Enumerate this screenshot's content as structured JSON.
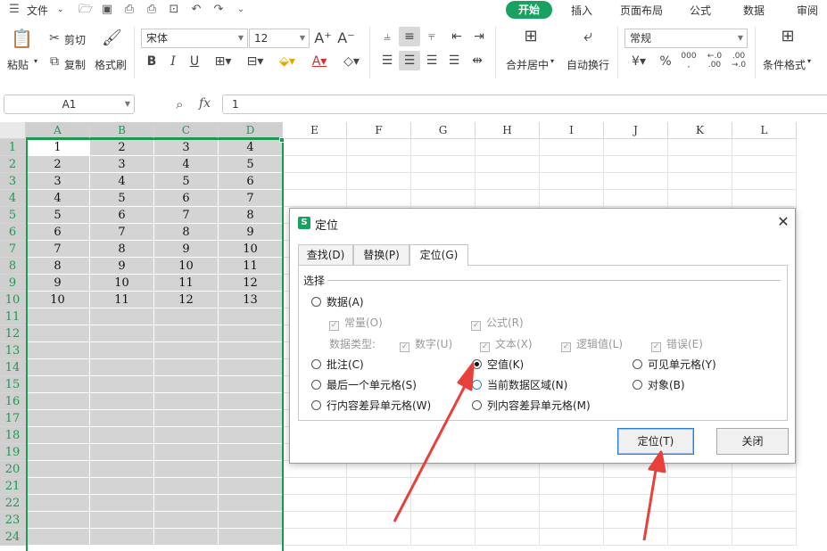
{
  "menubar": {
    "file_label": "文件",
    "tabs": [
      "开始",
      "插入",
      "页面布局",
      "公式",
      "数据",
      "审阅"
    ]
  },
  "ribbon": {
    "paste": "粘贴",
    "cut": "剪切",
    "copy": "复制",
    "format_painter": "格式刷",
    "font_name": "宋体",
    "font_size": "12",
    "merge_center": "合并居中",
    "wrap_text": "自动换行",
    "number_format": "常规",
    "conditional_format": "条件格式",
    "pct": "%"
  },
  "formula_bar": {
    "name_box": "A1",
    "fx": "fx",
    "value": "1"
  },
  "sheet": {
    "columns": [
      "A",
      "B",
      "C",
      "D",
      "E",
      "F",
      "G",
      "H",
      "I",
      "J",
      "K",
      "L"
    ],
    "rows": [
      "1",
      "2",
      "3",
      "4",
      "5",
      "6",
      "7",
      "8",
      "9",
      "10",
      "11",
      "12",
      "13",
      "14",
      "15",
      "16",
      "17",
      "18",
      "19",
      "20",
      "21",
      "22",
      "23",
      "24"
    ],
    "data": [
      [
        "1",
        "2",
        "3",
        "4"
      ],
      [
        "2",
        "3",
        "4",
        "5"
      ],
      [
        "3",
        "4",
        "5",
        "6"
      ],
      [
        "4",
        "5",
        "6",
        "7"
      ],
      [
        "5",
        "6",
        "7",
        "8"
      ],
      [
        "6",
        "7",
        "8",
        "9"
      ],
      [
        "7",
        "8",
        "9",
        "10"
      ],
      [
        "8",
        "9",
        "10",
        "11"
      ],
      [
        "9",
        "10",
        "11",
        "12"
      ],
      [
        "10",
        "11",
        "12",
        "13"
      ]
    ]
  },
  "dialog": {
    "title": "定位",
    "tabs": [
      "查找(D)",
      "替换(P)",
      "定位(G)"
    ],
    "section": "选择",
    "opt_data": "数据(A)",
    "chk_constant": "常量(O)",
    "chk_formula": "公式(R)",
    "data_type_label": "数据类型:",
    "chk_number": "数字(U)",
    "chk_text": "文本(X)",
    "chk_logic": "逻辑值(L)",
    "chk_error": "错误(E)",
    "opt_comment": "批注(C)",
    "opt_blank": "空值(K)",
    "opt_visible": "可见单元格(Y)",
    "opt_last_cell": "最后一个单元格(S)",
    "opt_current_region": "当前数据区域(N)",
    "opt_object": "对象(B)",
    "opt_row_diff": "行内容差异单元格(W)",
    "opt_col_diff": "列内容差异单元格(M)",
    "btn_locate": "定位(T)",
    "btn_close": "关闭"
  },
  "colors": {
    "accent": "#19a15f",
    "selection_border": "#1a9a4f",
    "annotation_arrow": "#e8413c"
  }
}
